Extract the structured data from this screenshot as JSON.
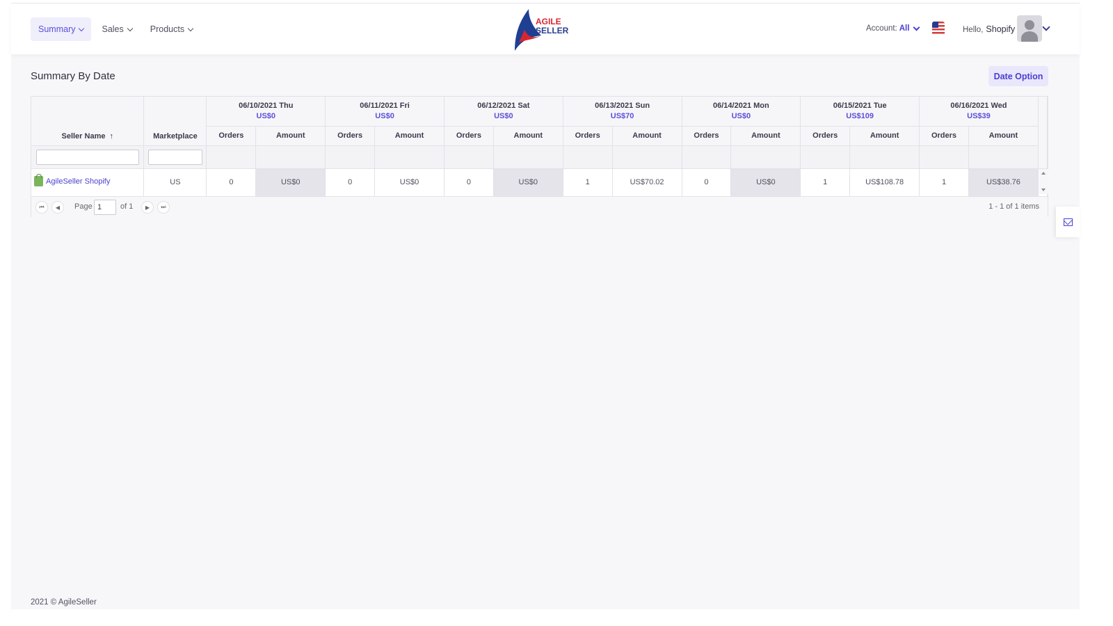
{
  "nav": [
    {
      "label": "Summary",
      "active": true
    },
    {
      "label": "Sales",
      "active": false
    },
    {
      "label": "Products",
      "active": false
    }
  ],
  "logo": {
    "line1": "AGILE",
    "line2": "SELLER"
  },
  "account": {
    "label": "Account:",
    "value": "All"
  },
  "user": {
    "greeting": "Hello,",
    "name": "Shopify"
  },
  "page_title": "Summary By Date",
  "date_option_label": "Date Option",
  "grid": {
    "seller_header": "Seller Name",
    "sort_indicator": "↑",
    "marketplace_header": "Marketplace",
    "orders_label": "Orders",
    "amount_label": "Amount",
    "dates": [
      {
        "date": "06/10/2021 Thu",
        "total": "US$0"
      },
      {
        "date": "06/11/2021 Fri",
        "total": "US$0"
      },
      {
        "date": "06/12/2021 Sat",
        "total": "US$0"
      },
      {
        "date": "06/13/2021 Sun",
        "total": "US$70"
      },
      {
        "date": "06/14/2021 Mon",
        "total": "US$0"
      },
      {
        "date": "06/15/2021 Tue",
        "total": "US$109"
      },
      {
        "date": "06/16/2021 Wed",
        "total": "US$39"
      }
    ],
    "rows": [
      {
        "seller": "AgileSeller Shopify",
        "marketplace": "US",
        "cells": [
          {
            "orders": "0",
            "amount": "US$0"
          },
          {
            "orders": "0",
            "amount": "US$0"
          },
          {
            "orders": "0",
            "amount": "US$0"
          },
          {
            "orders": "1",
            "amount": "US$70.02"
          },
          {
            "orders": "0",
            "amount": "US$0"
          },
          {
            "orders": "1",
            "amount": "US$108.78"
          },
          {
            "orders": "1",
            "amount": "US$38.76"
          }
        ]
      }
    ]
  },
  "pager": {
    "page_label": "Page",
    "page_value": "1",
    "of_label": "of 1",
    "info": "1 - 1 of 1 items"
  },
  "footer": "2021 © AgileSeller"
}
